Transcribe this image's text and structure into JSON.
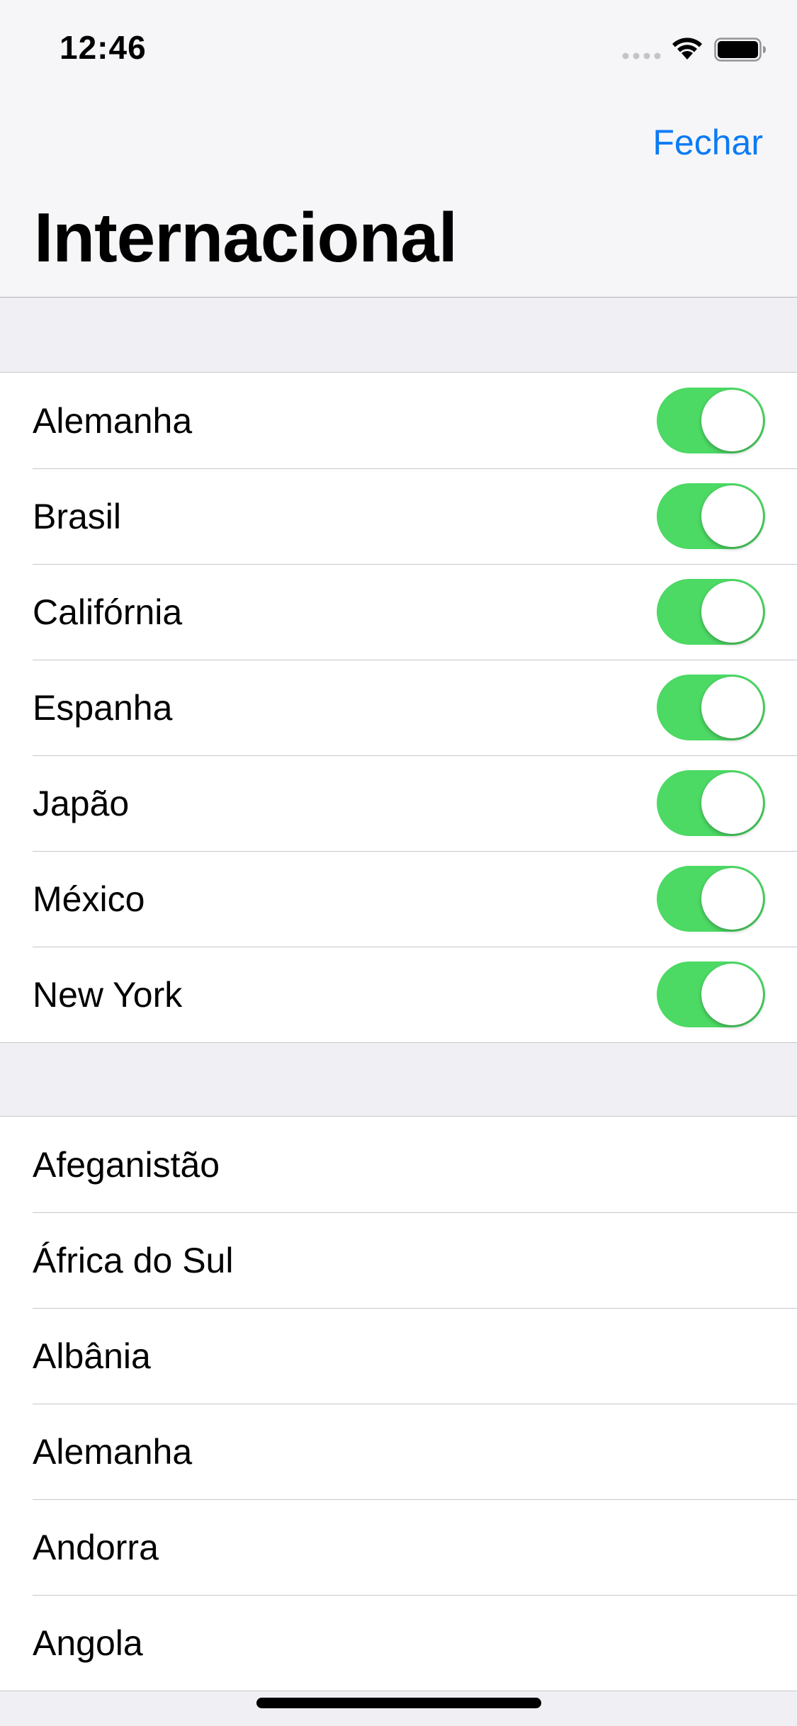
{
  "status_bar": {
    "time": "12:46",
    "icons": [
      "signal-dots-icon",
      "wifi-icon",
      "battery-icon"
    ]
  },
  "nav": {
    "close_label": "Fechar",
    "title": "Internacional"
  },
  "colors": {
    "accent": "#0a7bf5",
    "toggle_on": "#4cd964",
    "background": "#efeff4"
  },
  "enabled_calendars": [
    {
      "label": "Alemanha",
      "enabled": true
    },
    {
      "label": "Brasil",
      "enabled": true
    },
    {
      "label": "Califórnia",
      "enabled": true
    },
    {
      "label": "Espanha",
      "enabled": true
    },
    {
      "label": "Japão",
      "enabled": true
    },
    {
      "label": "México",
      "enabled": true
    },
    {
      "label": "New York",
      "enabled": true
    }
  ],
  "countries": [
    {
      "label": "Afeganistão"
    },
    {
      "label": "África do Sul"
    },
    {
      "label": "Albânia"
    },
    {
      "label": "Alemanha"
    },
    {
      "label": "Andorra"
    },
    {
      "label": "Angola"
    }
  ]
}
